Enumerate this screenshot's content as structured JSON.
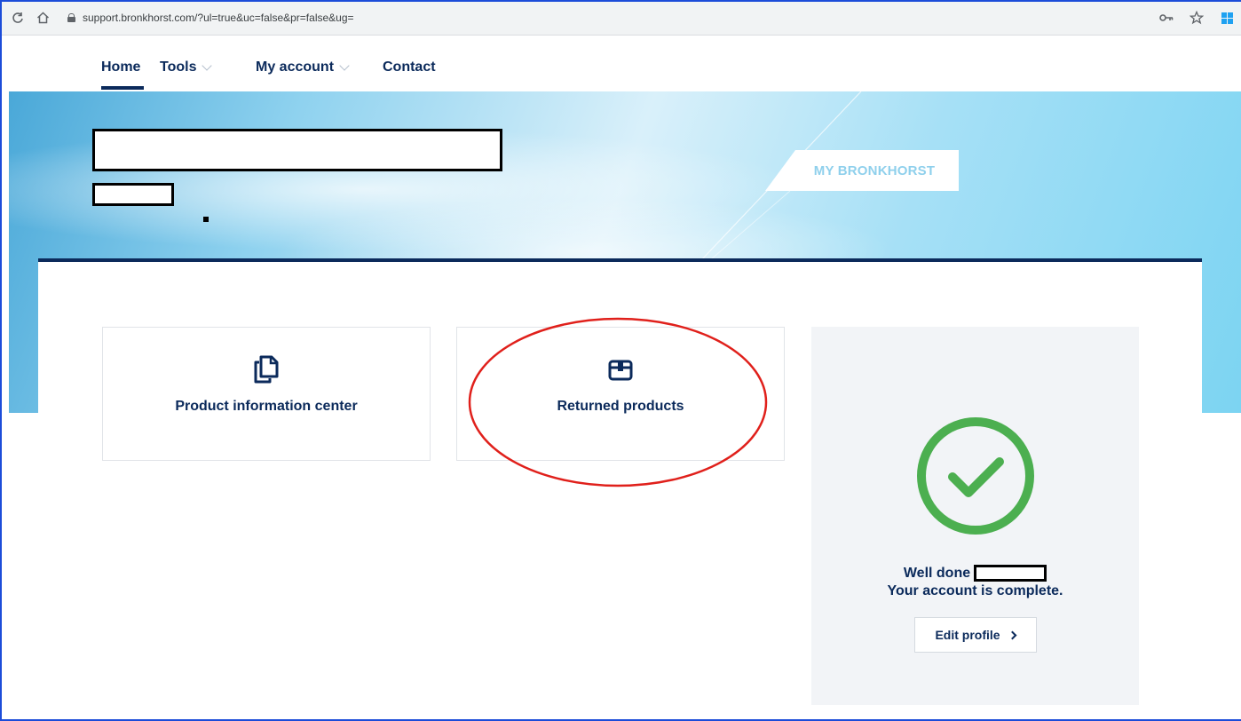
{
  "browser": {
    "url": "support.bronkhorst.com/?ul=true&uc=false&pr=false&ug="
  },
  "nav": {
    "items": [
      {
        "label": "Home"
      },
      {
        "label": "Tools"
      },
      {
        "label": "My account"
      },
      {
        "label": "Contact"
      }
    ]
  },
  "hero": {
    "badge": "MY BRONKHORST"
  },
  "tiles": [
    {
      "label": "Product information center",
      "icon": "documents-icon"
    },
    {
      "label": "Returned products",
      "icon": "box-icon"
    }
  ],
  "status": {
    "well_done": "Well done",
    "complete": "Your account is complete.",
    "edit_label": "Edit profile"
  },
  "colors": {
    "navy": "#0b2a5b",
    "success": "#4caf50",
    "annotation": "#e0201b"
  }
}
